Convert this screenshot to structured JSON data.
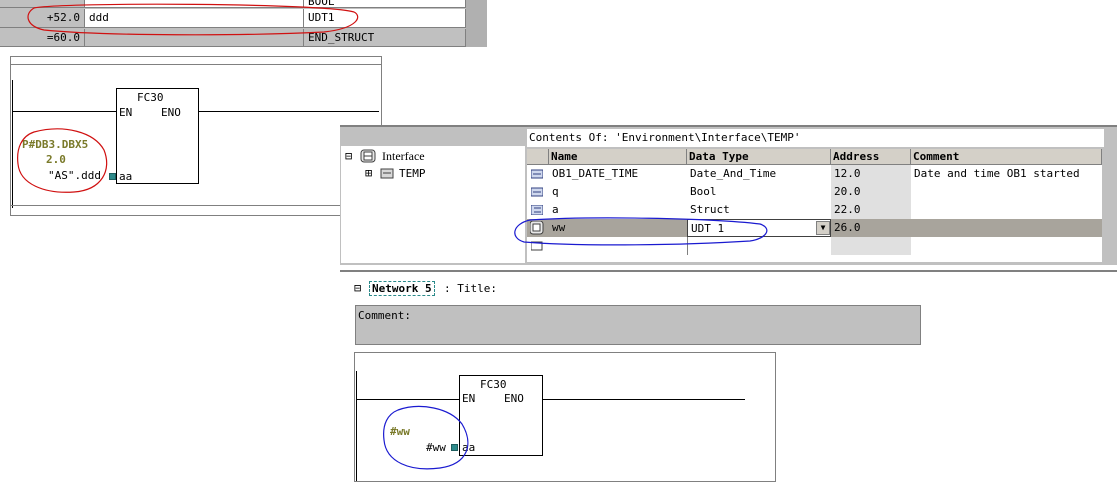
{
  "decl_table": {
    "rows": [
      {
        "address": "+52.0",
        "name": "ddd",
        "type": "UDT1"
      },
      {
        "address": "=60.0",
        "name": "",
        "type": "END_STRUCT"
      }
    ],
    "partial_top_type": "BOOL"
  },
  "ladder_top": {
    "block_name": "FC30",
    "en": "EN",
    "eno": "ENO",
    "param": "aa",
    "actual_line1": "P#DB3.DBX5",
    "actual_line2": "2.0",
    "actual_line3": "\"AS\".ddd"
  },
  "editor": {
    "contents_title": "Contents Of: 'Environment\\Interface\\TEMP'",
    "tree": {
      "root_label": "Interface",
      "child_label": "TEMP",
      "root_expand": "⊟",
      "child_expand": "⊞"
    },
    "columns": [
      "Name",
      "Data Type",
      "Address",
      "Comment"
    ],
    "rows": [
      {
        "name": "OB1_DATE_TIME",
        "type": "Date_And_Time",
        "address": "12.0",
        "comment": "Date and time OB1 started"
      },
      {
        "name": "q",
        "type": "Bool",
        "address": "20.0",
        "comment": ""
      },
      {
        "name": "a",
        "type": "Struct",
        "address": "22.0",
        "comment": ""
      },
      {
        "name": "ww",
        "type": "UDT 1",
        "address": "26.0",
        "comment": ""
      },
      {
        "name": "",
        "type": "",
        "address": "",
        "comment": ""
      }
    ],
    "dropdown_arrow": "▼"
  },
  "network": {
    "collapse_icon": "⊟",
    "label": "Network 5",
    "title_sep": ": Title:",
    "comment_label": "Comment:",
    "block_name": "FC30",
    "en": "EN",
    "eno": "ENO",
    "param": "aa",
    "actual_top": "#ww",
    "actual": "#ww"
  },
  "colors": {
    "annotation_red": "#d01010",
    "annotation_blue": "#1a1ad0",
    "olive_text": "#7a7a2a",
    "pin_teal": "#2e8b8b"
  }
}
